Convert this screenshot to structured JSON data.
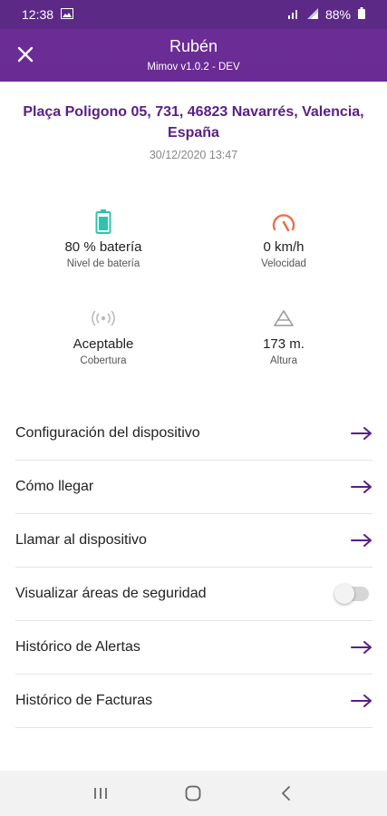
{
  "status_bar": {
    "time": "12:38",
    "battery": "88%"
  },
  "header": {
    "title": "Rubén",
    "subtitle": "Mimov v1.0.2 - DEV"
  },
  "location": {
    "address": "Plaça Poligono 05, 731, 46823 Navarrés, Valencia, España",
    "datetime": "30/12/2020 13:47"
  },
  "stats": [
    {
      "icon": "battery-icon",
      "value": "80 % batería",
      "label": "Nivel de batería"
    },
    {
      "icon": "speedometer-icon",
      "value": "0 km/h",
      "label": "Velocidad"
    },
    {
      "icon": "signal-coverage-icon",
      "value": "Aceptable",
      "label": "Cobertura"
    },
    {
      "icon": "altitude-triangle-icon",
      "value": "173 m.",
      "label": "Altura"
    }
  ],
  "menu": [
    {
      "label": "Configuración del dispositivo",
      "control": "arrow"
    },
    {
      "label": "Cómo llegar",
      "control": "arrow"
    },
    {
      "label": "Llamar al dispositivo",
      "control": "arrow"
    },
    {
      "label": "Visualizar áreas de seguridad",
      "control": "toggle",
      "toggle_on": false
    },
    {
      "label": "Histórico de Alertas",
      "control": "arrow"
    },
    {
      "label": "Histórico de Facturas",
      "control": "arrow"
    }
  ],
  "colors": {
    "brand": "#6a2b94",
    "battery": "#2cc4b0",
    "speed": "#e8704a",
    "arrow": "#5a1e86"
  }
}
